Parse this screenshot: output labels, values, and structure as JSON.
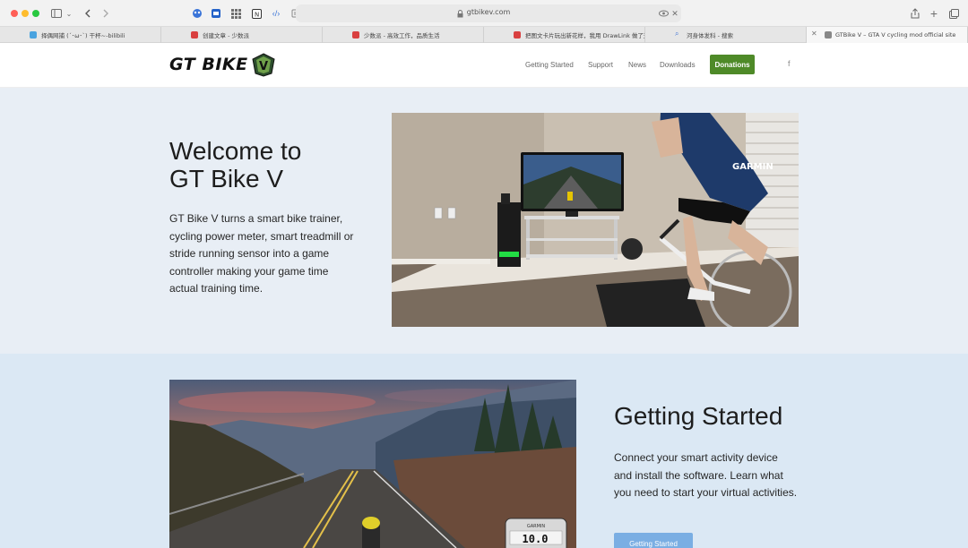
{
  "browser": {
    "url": "gtbikev.com",
    "tabs": [
      {
        "label": "择偶网捕 (´･ω･`) 干杯~-bilibili",
        "color": "#4aa3df"
      },
      {
        "label": "创建文章 - 少数派",
        "color": "#d94040"
      },
      {
        "label": "少数派 - 高效工作，品质生活",
        "color": "#d94040"
      },
      {
        "label": "把图文卡片玩出新花样，我用 DrawLink 做了这些...",
        "color": "#d94040"
      },
      {
        "label": "河身体发科 - 搜索",
        "color": "#4a7bd6"
      },
      {
        "label": "GTBike V – GTA V cycling mod official site",
        "color": "#888888"
      }
    ]
  },
  "site": {
    "logo_text": "GT BIKE",
    "logo_emblem_text": "V",
    "nav": [
      "Getting Started",
      "Support",
      "News",
      "Downloads"
    ],
    "donate": "Donations",
    "facebook": "f"
  },
  "hero": {
    "title_line1": "Welcome to",
    "title_line2": "GT Bike V",
    "description": "GT Bike V turns a smart bike trainer, cycling power meter, smart treadmill or stride running sensor into a game controller making your game time actual training time."
  },
  "getting_started": {
    "title": "Getting Started",
    "description": "Connect your smart activity device and install the software. Learn what you need to start your virtual activities.",
    "button": "Getting Started",
    "gauge_value": "10.0",
    "gauge_brand": "GARMIN"
  },
  "photo": {
    "jersey_text": "GARMIN"
  }
}
